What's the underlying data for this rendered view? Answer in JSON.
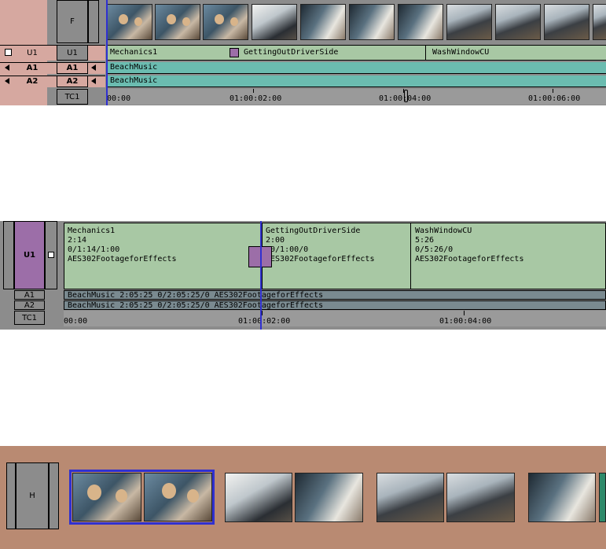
{
  "panel1": {
    "track_f": "F",
    "tracks": [
      {
        "source": "U1",
        "record": "U1"
      },
      {
        "source": "A1",
        "record": "A1"
      },
      {
        "source": "A2",
        "record": "A2"
      }
    ],
    "tc_label": "TC1",
    "v_clips": [
      "Mechanics1",
      "GettingOutDriverSide",
      "WashWindowCU"
    ],
    "a1_clip": "BeachMusic",
    "a2_clip": "BeachMusic",
    "timecodes": [
      "00:00",
      "01:00:02:00",
      "01:00:04:00",
      "01:00:06:00"
    ]
  },
  "panel2": {
    "track_u1": "U1",
    "track_a1": "A1",
    "track_a2": "A2",
    "tc_label": "TC1",
    "clips": [
      {
        "name": "Mechanics1",
        "dur": "2:14",
        "tc": "0/1:14/1:00",
        "bin": "AES302FootageforEffects"
      },
      {
        "name": "GettingOutDriverSide",
        "dur": "2:00",
        "tc": "00/1:00/0",
        "bin": "AES302FootageforEffects"
      },
      {
        "name": "WashWindowCU",
        "dur": "5:26",
        "tc": "0/5:26/0",
        "bin": "AES302FootageforEffects"
      }
    ],
    "a1_text": "BeachMusic  2:05:25  0/2:05:25/0  AES302FootageforEffects",
    "a2_text": "BeachMusic  2:05:25  0/2:05:25/0  AES302FootageforEffects",
    "timecodes": [
      "00:00",
      "01:00:02:00",
      "01:00:04:00"
    ]
  },
  "panel3": {
    "track_h": "H"
  },
  "colors": {
    "clip_green": "#a8c8a4",
    "audio_teal": "#6bbcb0",
    "audio_gray": "#7a8a90",
    "track_purple": "#9c6ea8",
    "salmon": "#d6a8a0",
    "tan": "#b98a72",
    "blue_cursor": "#3030d0"
  }
}
